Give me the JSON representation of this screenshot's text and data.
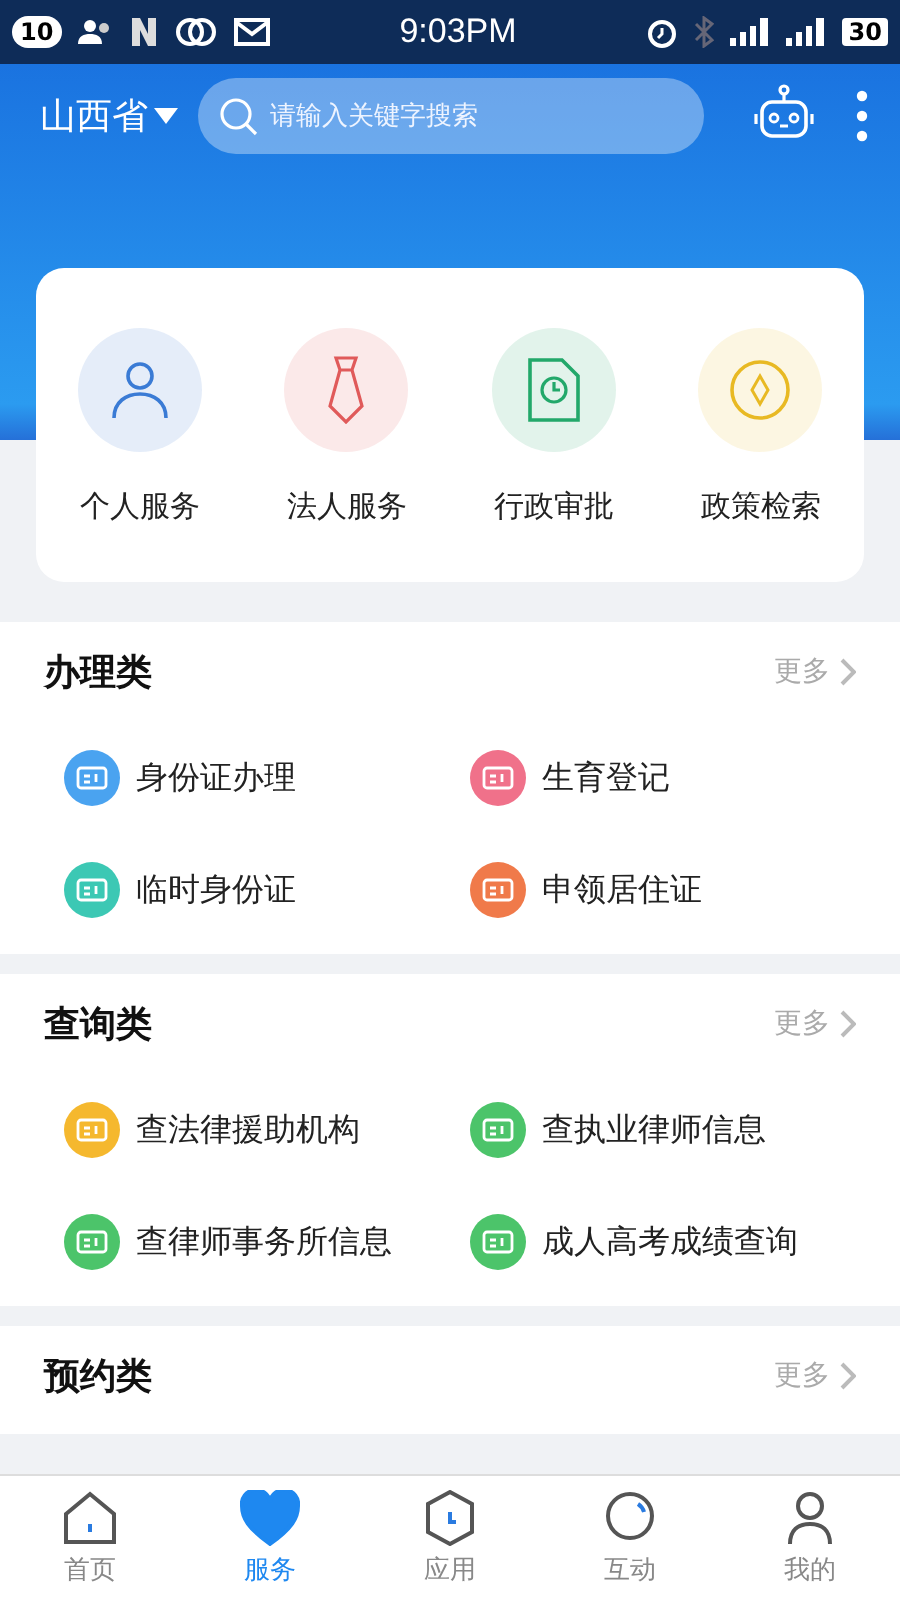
{
  "status_bar": {
    "badge": "10",
    "time": "9:03PM",
    "battery": "30"
  },
  "header": {
    "region": "山西省",
    "search": {
      "placeholder": "请输入关键字搜索"
    }
  },
  "quick_services": [
    {
      "label": "个人服务",
      "kind": "person",
      "color": "#3a7bd5"
    },
    {
      "label": "法人服务",
      "kind": "tie",
      "color": "#e05a5a"
    },
    {
      "label": "行政审批",
      "kind": "document",
      "color": "#22a86a"
    },
    {
      "label": "政策检索",
      "kind": "compass",
      "color": "#e8b923"
    }
  ],
  "sections": [
    {
      "title": "办理类",
      "more": "更多",
      "items": [
        {
          "label": "身份证办理",
          "color": "#4aa3f0"
        },
        {
          "label": "生育登记",
          "color": "#f0718a"
        },
        {
          "label": "临时身份证",
          "color": "#3cc8b4"
        },
        {
          "label": "申领居住证",
          "color": "#f07a4a"
        }
      ]
    },
    {
      "title": "查询类",
      "more": "更多",
      "items": [
        {
          "label": "查法律援助机构",
          "color": "#f5b82e"
        },
        {
          "label": "查执业律师信息",
          "color": "#4cc46a"
        },
        {
          "label": "查律师事务所信息",
          "color": "#4cc46a"
        },
        {
          "label": "成人高考成绩查询",
          "color": "#4cc46a"
        }
      ]
    },
    {
      "title": "预约类",
      "more": "更多"
    }
  ],
  "tab_bar": [
    {
      "label": "首页",
      "kind": "home",
      "selected": false
    },
    {
      "label": "服务",
      "kind": "heart",
      "selected": true
    },
    {
      "label": "应用",
      "kind": "clock",
      "selected": false
    },
    {
      "label": "互动",
      "kind": "chat",
      "selected": false
    },
    {
      "label": "我的",
      "kind": "user",
      "selected": false
    }
  ]
}
